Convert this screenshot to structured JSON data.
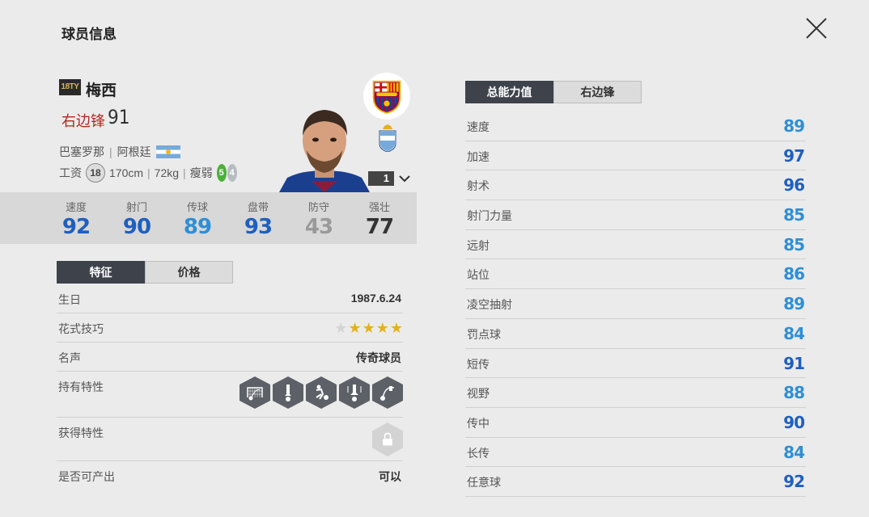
{
  "header": {
    "title": "球员信息"
  },
  "player": {
    "season": "18TY",
    "name": "梅西",
    "position": "右边锋",
    "overall": "91",
    "club": "巴塞罗那",
    "nation": "阿根廷",
    "wage_label": "工资",
    "wage": "18",
    "height": "170cm",
    "weight": "72kg",
    "body_type": "瘦弱",
    "left_foot": "5",
    "right_foot": "4",
    "level": "1"
  },
  "summary_stats": [
    {
      "label": "速度",
      "value": "92",
      "color": "#1f5fbf"
    },
    {
      "label": "射门",
      "value": "90",
      "color": "#1f5fbf"
    },
    {
      "label": "传球",
      "value": "89",
      "color": "#2e8fd6"
    },
    {
      "label": "盘带",
      "value": "93",
      "color": "#1f5fbf"
    },
    {
      "label": "防守",
      "value": "43",
      "color": "#9a9a9a"
    },
    {
      "label": "强壮",
      "value": "77",
      "color": "#333333"
    }
  ],
  "left_tabs": {
    "active": "特征",
    "inactive": "价格"
  },
  "features": {
    "birthday_label": "生日",
    "birthday": "1987.6.24",
    "skill_label": "花式技巧",
    "skill_stars": 4,
    "skill_max": 5,
    "reputation_label": "名声",
    "reputation": "传奇球员",
    "traits_label": "持有特性",
    "traits": [
      "finesse-shot-icon",
      "outside-foot-shot-icon",
      "dribbler-icon",
      "speed-dribbler-icon",
      "chip-shot-icon"
    ],
    "acquired_label": "获得特性",
    "tradable_label": "是否可产出",
    "tradable": "可以"
  },
  "right_tabs": {
    "active": "总能力值",
    "inactive": "右边锋"
  },
  "attributes": [
    {
      "label": "速度",
      "value": "89",
      "color": "#2e8fd6"
    },
    {
      "label": "加速",
      "value": "97",
      "color": "#1f5fbf"
    },
    {
      "label": "射术",
      "value": "96",
      "color": "#1f5fbf"
    },
    {
      "label": "射门力量",
      "value": "85",
      "color": "#2e8fd6"
    },
    {
      "label": "远射",
      "value": "85",
      "color": "#2e8fd6"
    },
    {
      "label": "站位",
      "value": "86",
      "color": "#2e8fd6"
    },
    {
      "label": "凌空抽射",
      "value": "89",
      "color": "#2e8fd6"
    },
    {
      "label": "罚点球",
      "value": "84",
      "color": "#2e8fd6"
    },
    {
      "label": "短传",
      "value": "91",
      "color": "#1f5fbf"
    },
    {
      "label": "视野",
      "value": "88",
      "color": "#2e8fd6"
    },
    {
      "label": "传中",
      "value": "90",
      "color": "#1f5fbf"
    },
    {
      "label": "长传",
      "value": "84",
      "color": "#2e8fd6"
    },
    {
      "label": "任意球",
      "value": "92",
      "color": "#1f5fbf"
    }
  ]
}
